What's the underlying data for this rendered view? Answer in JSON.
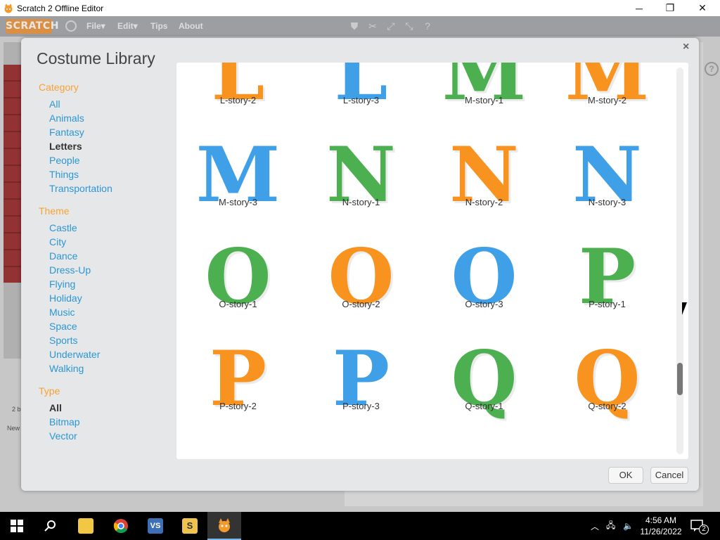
{
  "window": {
    "title": "Scratch 2 Offline Editor",
    "minimize": "─",
    "restore": "❐",
    "close": "✕"
  },
  "menubar": {
    "logo": "SCRATCH",
    "items": [
      "File▾",
      "Edit▾",
      "Tips",
      "About"
    ],
    "tools": [
      "duplicate-icon",
      "delete-icon",
      "grow-icon",
      "shrink-icon",
      "help-icon"
    ]
  },
  "dialog": {
    "title": "Costume Library",
    "close": "×",
    "category_heading": "Category",
    "categories": [
      "All",
      "Animals",
      "Fantasy",
      "Letters",
      "People",
      "Things",
      "Transportation"
    ],
    "active_category": "Letters",
    "theme_heading": "Theme",
    "themes": [
      "Castle",
      "City",
      "Dance",
      "Dress-Up",
      "Flying",
      "Holiday",
      "Music",
      "Space",
      "Sports",
      "Underwater",
      "Walking"
    ],
    "type_heading": "Type",
    "types": [
      "All",
      "Bitmap",
      "Vector"
    ],
    "active_type": "All",
    "ok": "OK",
    "cancel": "Cancel"
  },
  "costumes": [
    {
      "letter": "L",
      "label": "L-story-2",
      "color": "#f7931e",
      "style": "hatched"
    },
    {
      "letter": "L",
      "label": "L-story-3",
      "color": "#3fa0e8",
      "style": "solid"
    },
    {
      "letter": "M",
      "label": "M-story-1",
      "color": "#4caf50",
      "style": "hatched"
    },
    {
      "letter": "M",
      "label": "M-story-2",
      "color": "#f7931e",
      "style": "hatched"
    },
    {
      "letter": "M",
      "label": "M-story-3",
      "color": "#3fa0e8",
      "style": "solid"
    },
    {
      "letter": "N",
      "label": "N-story-1",
      "color": "#4caf50",
      "style": "hatched"
    },
    {
      "letter": "N",
      "label": "N-story-2",
      "color": "#f7931e",
      "style": "hatched"
    },
    {
      "letter": "N",
      "label": "N-story-3",
      "color": "#3fa0e8",
      "style": "solid"
    },
    {
      "letter": "O",
      "label": "O-story-1",
      "color": "#4caf50",
      "style": "hatched"
    },
    {
      "letter": "O",
      "label": "O-story-2",
      "color": "#f7931e",
      "style": "hatched"
    },
    {
      "letter": "O",
      "label": "O-story-3",
      "color": "#3fa0e8",
      "style": "solid"
    },
    {
      "letter": "P",
      "label": "P-story-1",
      "color": "#4caf50",
      "style": "hatched"
    },
    {
      "letter": "P",
      "label": "P-story-2",
      "color": "#f7931e",
      "style": "hatched"
    },
    {
      "letter": "P",
      "label": "P-story-3",
      "color": "#3fa0e8",
      "style": "solid"
    },
    {
      "letter": "Q",
      "label": "Q-story-1",
      "color": "#4caf50",
      "style": "hatched"
    },
    {
      "letter": "Q",
      "label": "Q-story-2",
      "color": "#f7931e",
      "style": "hatched"
    }
  ],
  "taskbar": {
    "apps": [
      {
        "name": "start-icon",
        "color": "#ffffff"
      },
      {
        "name": "search-icon",
        "color": "#ffffff"
      },
      {
        "name": "file-explorer-icon",
        "color": "#f2c744"
      },
      {
        "name": "chrome-icon",
        "color": "#db4437"
      },
      {
        "name": "visual-studio-icon",
        "color": "#3c6fb4"
      },
      {
        "name": "sublime-icon",
        "color": "#f0c24e"
      },
      {
        "name": "scratch-icon",
        "color": "#f29b2c"
      }
    ],
    "time": "4:56 AM",
    "date": "11/26/2022",
    "notifications": "2"
  },
  "stage_info": {
    "sprite_count": "2 b",
    "new_label": "New"
  }
}
